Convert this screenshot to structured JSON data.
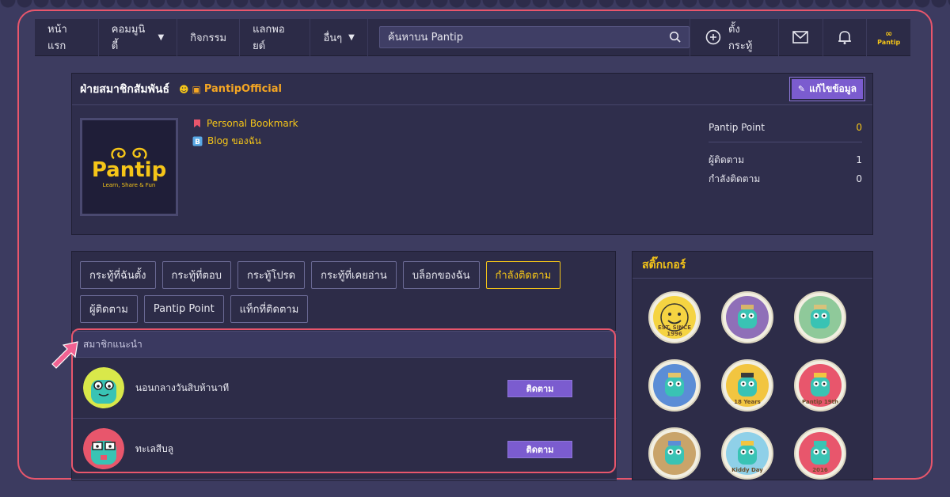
{
  "nav": {
    "home": "หน้าแรก",
    "community": "คอมมูนิตี้",
    "activities": "กิจกรรม",
    "points": "แลกพอยต์",
    "others": "อื่นๆ",
    "search_placeholder": "ค้นหาบน Pantip",
    "new_topic": "ตั้งกระทู้"
  },
  "profile": {
    "title": "ฝ่ายสมาชิกสัมพันธ์",
    "official": "PantipOfficial",
    "edit_label": "แก้ไขข้อมูล",
    "logo_text": "Pantip",
    "logo_tagline": "Learn, Share & Fun",
    "links": [
      "Personal Bookmark",
      "Blog ของฉัน"
    ],
    "stats": {
      "point_label": "Pantip Point",
      "point_value": "0",
      "followers_label": "ผู้ติดตาม",
      "followers_value": "1",
      "following_label": "กำลังติดตาม",
      "following_value": "0"
    }
  },
  "tabs": [
    {
      "label": "กระทู้ที่ฉันตั้ง"
    },
    {
      "label": "กระทู้ที่ตอบ"
    },
    {
      "label": "กระทู้โปรด"
    },
    {
      "label": "กระทู้ที่เคยอ่าน"
    },
    {
      "label": "บล็อกของฉัน"
    },
    {
      "label": "กำลังติดตาม",
      "active": true
    },
    {
      "label": "ผู้ติดตาม"
    },
    {
      "label": "Pantip Point"
    },
    {
      "label": "แท็กที่ติดตาม"
    }
  ],
  "recommend": {
    "heading": "สมาชิกแนะนำ",
    "members": [
      {
        "name": "นอนกลางวันสิบห้านาที",
        "follow": "ติดตาม"
      },
      {
        "name": "ทะเลสีบลู",
        "follow": "ติดตาม"
      }
    ]
  },
  "stickers": {
    "heading": "สติ๊กเกอร์",
    "items": [
      {
        "icon": "smiley-sticker-icon",
        "tag": "EST. SINCE 1996"
      },
      {
        "icon": "ship-sticker-icon",
        "tag": ""
      },
      {
        "icon": "sailor-sticker-icon",
        "tag": ""
      },
      {
        "icon": "football-sticker-icon",
        "tag": ""
      },
      {
        "icon": "anniversary-sticker-icon",
        "tag": "18 Years"
      },
      {
        "icon": "pantip-19th-sticker-icon",
        "tag": "Pantip 19th"
      },
      {
        "icon": "graduate-sticker-icon",
        "tag": ""
      },
      {
        "icon": "kiddy-day-sticker-icon",
        "tag": "Kiddy Day"
      },
      {
        "icon": "new-year-2016-sticker-icon",
        "tag": "2016"
      }
    ]
  },
  "colors": {
    "accent_yellow": "#f5c518",
    "button_purple": "#7b5ccf",
    "highlight_red": "#e8566c"
  }
}
